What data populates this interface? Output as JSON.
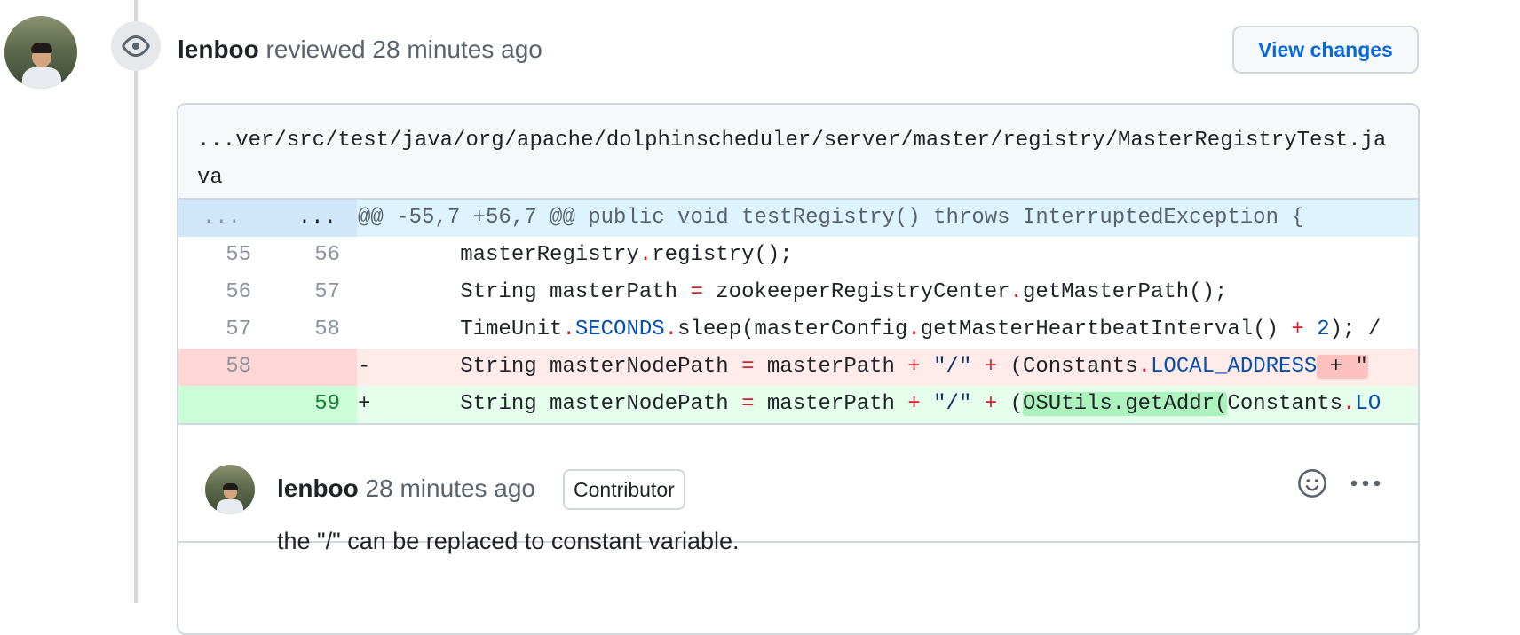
{
  "review": {
    "author": "lenboo",
    "action": "reviewed",
    "time": "28 minutes ago",
    "view_changes_label": "View changes"
  },
  "file": {
    "path_line1": "...ver/src/test/java/org/apache/dolphinscheduler/server/master/registry/MasterRegistryTest.ja",
    "path_line2": "va"
  },
  "diff": {
    "hunk": {
      "left": "...",
      "right": "...",
      "text": "@@ -55,7 +56,7 @@ public void testRegistry() throws InterruptedException {"
    },
    "rows": [
      {
        "old": "55",
        "new": "56",
        "type": "context"
      },
      {
        "old": "56",
        "new": "57",
        "type": "context"
      },
      {
        "old": "57",
        "new": "58",
        "type": "context"
      },
      {
        "old": "58",
        "new": "",
        "type": "deletion",
        "sign": "-"
      },
      {
        "old": "",
        "new": "59",
        "type": "addition",
        "sign": "+"
      }
    ],
    "tokens": {
      "r1": [
        "masterRegistry",
        ".",
        "registry();"
      ],
      "r2": [
        "String masterPath ",
        "=",
        " zookeeperRegistryCenter",
        ".",
        "getMasterPath();"
      ],
      "r3": [
        "TimeUnit",
        ".",
        "SECONDS",
        ".",
        "sleep(masterConfig",
        ".",
        "getMasterHeartbeatInterval() ",
        "+",
        " ",
        "2",
        "); /"
      ],
      "r4": [
        "String masterNodePath ",
        "=",
        " masterPath ",
        "+",
        " ",
        "\"/\"",
        " ",
        "+",
        " (Constants",
        ".",
        "LOCAL_ADDRESS",
        " + \""
      ],
      "r5": [
        "String masterNodePath ",
        "=",
        " masterPath ",
        "+",
        " ",
        "\"/\"",
        " ",
        "+",
        " (",
        "OSUtils.getAddr(",
        "Constants",
        ".",
        "LO"
      ]
    }
  },
  "comment": {
    "author": "lenboo",
    "time": "28 minutes ago",
    "badge": "Contributor",
    "body": "the \"/\" can be replaced to constant variable."
  },
  "icons": {
    "review_badge": "eye-icon",
    "reaction": "smiley-icon",
    "more": "kebab-horizontal-icon"
  },
  "colors": {
    "link": "#0969da",
    "deletion_bg": "#ffebe9",
    "addition_bg": "#e6ffec",
    "hunk_bg": "#ddf4ff",
    "operator": "#cf222e",
    "constant": "#0550ae"
  }
}
